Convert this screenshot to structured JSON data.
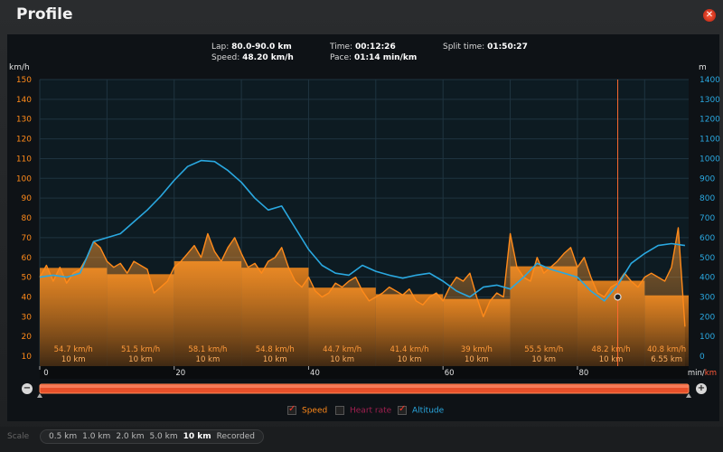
{
  "window": {
    "title": "Profile"
  },
  "stats": {
    "lap_label": "Lap:",
    "lap_value": "80.0-90.0 km",
    "speed_label": "Speed:",
    "speed_value": "48.20 km/h",
    "time_label": "Time:",
    "time_value": "00:12:26",
    "pace_label": "Pace:",
    "pace_value": "01:14 min/km",
    "split_label": "Split time:",
    "split_value": "01:50:27"
  },
  "colors": {
    "speed": "#ff8a1a",
    "altitude": "#2aa8e0",
    "heart_rate": "#a02050",
    "panel": "#0e1216",
    "cursor": "#ff6a30"
  },
  "chart_data": {
    "type": "line",
    "xlabel": "min/km",
    "ylabel_left": "km/h",
    "ylabel_right": "m",
    "x_ticks": [
      0,
      20,
      40,
      60,
      80
    ],
    "xlim": [
      0,
      96.55
    ],
    "y_left_lim": [
      5,
      150
    ],
    "y_left_ticks": [
      10,
      20,
      30,
      40,
      50,
      60,
      70,
      80,
      90,
      100,
      110,
      120,
      130,
      140,
      150
    ],
    "y_right_lim": [
      -50,
      1400
    ],
    "y_right_ticks": [
      0,
      100,
      200,
      300,
      400,
      500,
      600,
      700,
      800,
      900,
      1000,
      1100,
      1200,
      1300,
      1400
    ],
    "laps": [
      {
        "speed": "54.7 km/h",
        "dist": "10 km",
        "value": 54.7
      },
      {
        "speed": "51.5 km/h",
        "dist": "10 km",
        "value": 51.5
      },
      {
        "speed": "58.1 km/h",
        "dist": "10 km",
        "value": 58.1
      },
      {
        "speed": "54.8 km/h",
        "dist": "10 km",
        "value": 54.8
      },
      {
        "speed": "44.7 km/h",
        "dist": "10 km",
        "value": 44.7
      },
      {
        "speed": "41.4 km/h",
        "dist": "10 km",
        "value": 41.4
      },
      {
        "speed": "39 km/h",
        "dist": "10 km",
        "value": 39
      },
      {
        "speed": "55.5 km/h",
        "dist": "10 km",
        "value": 55.5
      },
      {
        "speed": "48.2 km/h",
        "dist": "10 km",
        "value": 48.2
      },
      {
        "speed": "40.8 km/h",
        "dist": "6.55 km",
        "value": 40.8
      }
    ],
    "series": [
      {
        "name": "Speed",
        "x": [
          0,
          1,
          2,
          3,
          4,
          5,
          6,
          7,
          8,
          9,
          10,
          11,
          12,
          13,
          14,
          15,
          16,
          17,
          18,
          19,
          20,
          21,
          22,
          23,
          24,
          25,
          26,
          27,
          28,
          29,
          30,
          31,
          32,
          33,
          34,
          35,
          36,
          37,
          38,
          39,
          40,
          41,
          42,
          43,
          44,
          45,
          46,
          47,
          48,
          49,
          50,
          51,
          52,
          53,
          54,
          55,
          56,
          57,
          58,
          59,
          60,
          61,
          62,
          63,
          64,
          65,
          66,
          67,
          68,
          69,
          70,
          71,
          72,
          73,
          74,
          75,
          76,
          77,
          78,
          79,
          80,
          81,
          82,
          83,
          84,
          85,
          86,
          87,
          88,
          89,
          90,
          91,
          92,
          93,
          94,
          95,
          96
        ],
        "y": [
          50,
          56,
          48,
          55,
          47,
          52,
          54,
          60,
          68,
          65,
          58,
          55,
          57,
          52,
          58,
          56,
          54,
          42,
          45,
          48,
          55,
          58,
          62,
          66,
          60,
          72,
          63,
          58,
          65,
          70,
          62,
          55,
          57,
          52,
          58,
          60,
          65,
          55,
          48,
          45,
          50,
          43,
          40,
          42,
          47,
          45,
          48,
          50,
          43,
          38,
          40,
          42,
          45,
          43,
          41,
          44,
          38,
          36,
          40,
          42,
          38,
          45,
          50,
          48,
          52,
          40,
          30,
          38,
          42,
          40,
          72,
          55,
          50,
          48,
          60,
          52,
          55,
          58,
          62,
          65,
          55,
          60,
          50,
          42,
          40,
          45,
          47,
          52,
          48,
          45,
          50,
          52,
          50,
          48,
          55,
          75,
          25
        ]
      },
      {
        "name": "Altitude",
        "x": [
          0,
          2,
          4,
          6,
          8,
          10,
          12,
          14,
          16,
          18,
          20,
          22,
          24,
          26,
          28,
          30,
          32,
          34,
          36,
          38,
          40,
          42,
          44,
          46,
          48,
          50,
          52,
          54,
          56,
          58,
          60,
          62,
          64,
          66,
          68,
          70,
          72,
          74,
          76,
          78,
          80,
          82,
          84,
          86,
          88,
          90,
          92,
          94,
          96
        ],
        "y": [
          400,
          410,
          400,
          420,
          580,
          600,
          620,
          680,
          740,
          810,
          890,
          960,
          990,
          985,
          940,
          880,
          800,
          740,
          760,
          650,
          540,
          460,
          420,
          410,
          460,
          430,
          410,
          395,
          410,
          420,
          380,
          330,
          300,
          350,
          360,
          340,
          400,
          470,
          440,
          420,
          400,
          330,
          280,
          360,
          470,
          520,
          560,
          570,
          560
        ]
      }
    ],
    "cursor_x": 86,
    "cursor_speed": 40
  },
  "axis": {
    "left_unit": "km/h",
    "right_unit": "m",
    "x_unit_a": "min/",
    "x_unit_b": "km"
  },
  "legend": {
    "speed": {
      "label": "Speed",
      "checked": true
    },
    "heart_rate": {
      "label": "Heart rate",
      "checked": false
    },
    "altitude": {
      "label": "Altitude",
      "checked": true
    }
  },
  "scale": {
    "label": "Scale",
    "options": [
      "0.5 km",
      "1.0 km",
      "2.0 km",
      "5.0 km",
      "10 km",
      "Recorded"
    ],
    "selected": "10 km"
  },
  "zoom": {
    "minus": "−",
    "plus": "+"
  }
}
